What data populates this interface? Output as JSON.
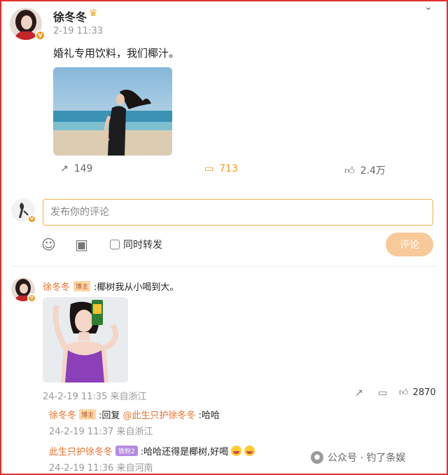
{
  "post": {
    "author": "徐冬冬",
    "time": "2-19 11:33",
    "text": "婚礼专用饮料，我们椰汁。",
    "actions": {
      "repost": "149",
      "comments": "713",
      "likes": "2.4万"
    }
  },
  "composer": {
    "placeholder": "发布你的评论",
    "repost_label": "同时转发",
    "submit_label": "评论"
  },
  "comments": [
    {
      "name": "徐冬冬",
      "badge": "博主",
      "text": ":椰树我从小喝到大。",
      "meta": "24-2-19 11:35 来自浙江",
      "like_count": "2870",
      "replies": [
        {
          "name": "徐冬冬",
          "badge": "博主",
          "prefix": ":回复",
          "mention": "@此生只护徐冬冬",
          "suffix": ":哈哈",
          "meta": "24-2-19 11:37 来自浙江"
        },
        {
          "name": "此生只护徐冬冬",
          "badge": "铁粉2",
          "text": ":哈哈还得是椰树,好喝",
          "meta": "24-2-19 11:36 来自河南"
        }
      ]
    }
  ],
  "watermark": "公众号 · 钓了条娱",
  "colors": {
    "accent": "#f29a1e",
    "name": "#e9702d",
    "frame": "#e0302c"
  }
}
